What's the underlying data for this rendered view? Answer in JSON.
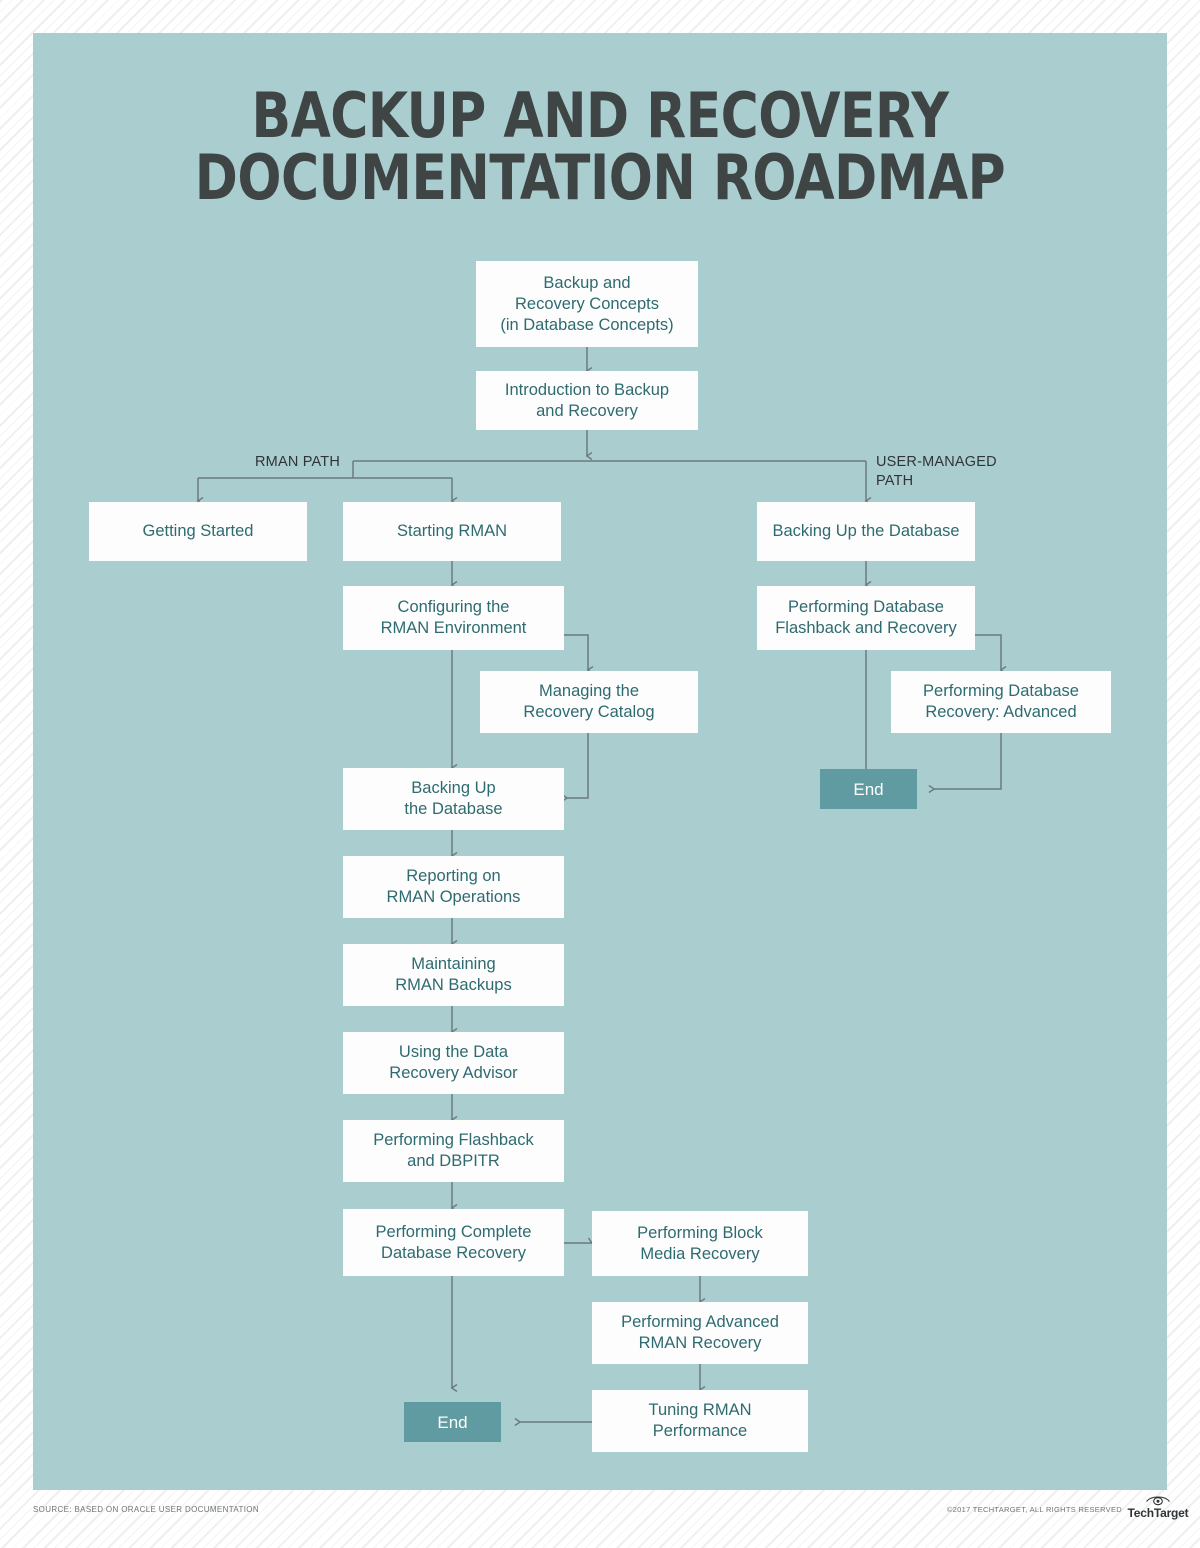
{
  "title": {
    "line1": "BACKUP AND RECOVERY",
    "line2": "DOCUMENTATION ROADMAP"
  },
  "colors": {
    "panel": "#aacdd0",
    "box_fill": "#fdfdfd",
    "box_text": "#2e6b70",
    "end_fill": "#5f9ba0",
    "end_text": "#ffffff",
    "title_text": "#3f4445",
    "connector": "#6b7b7d",
    "label_text": "#2f3436"
  },
  "path_labels": {
    "rman": "RMAN PATH",
    "user_managed": "USER-MANAGED\nPATH"
  },
  "nodes": {
    "concepts": "Backup and\nRecovery Concepts\n(in Database Concepts)",
    "intro": "Introduction to Backup\nand Recovery",
    "getting_started": "Getting Started",
    "starting_rman": "Starting RMAN",
    "configuring_rman": "Configuring the\nRMAN Environment",
    "managing_catalog": "Managing the\nRecovery Catalog",
    "backing_up_rman": "Backing Up\nthe Database",
    "reporting": "Reporting on\nRMAN Operations",
    "maintaining": "Maintaining\nRMAN Backups",
    "data_recovery_advisor": "Using the Data\nRecovery Advisor",
    "flashback_dbpitr": "Performing Flashback\nand DBPITR",
    "complete_recovery": "Performing Complete\nDatabase Recovery",
    "block_media": "Performing Block\nMedia Recovery",
    "advanced_rman": "Performing Advanced\nRMAN Recovery",
    "tuning_rman": "Tuning RMAN\nPerformance",
    "end_rman": "End",
    "backing_up_um": "Backing Up the Database",
    "flashback_recovery_um": "Performing Database\nFlashback and Recovery",
    "recovery_advanced_um": "Performing Database\nRecovery: Advanced",
    "end_um": "End"
  },
  "footer": {
    "source": "SOURCE: BASED ON ORACLE USER DOCUMENTATION",
    "copyright": "©2017 TECHTARGET, ALL RIGHTS RESERVED",
    "logo_word": "TechTarget",
    "logo_icon": "eye-icon"
  }
}
